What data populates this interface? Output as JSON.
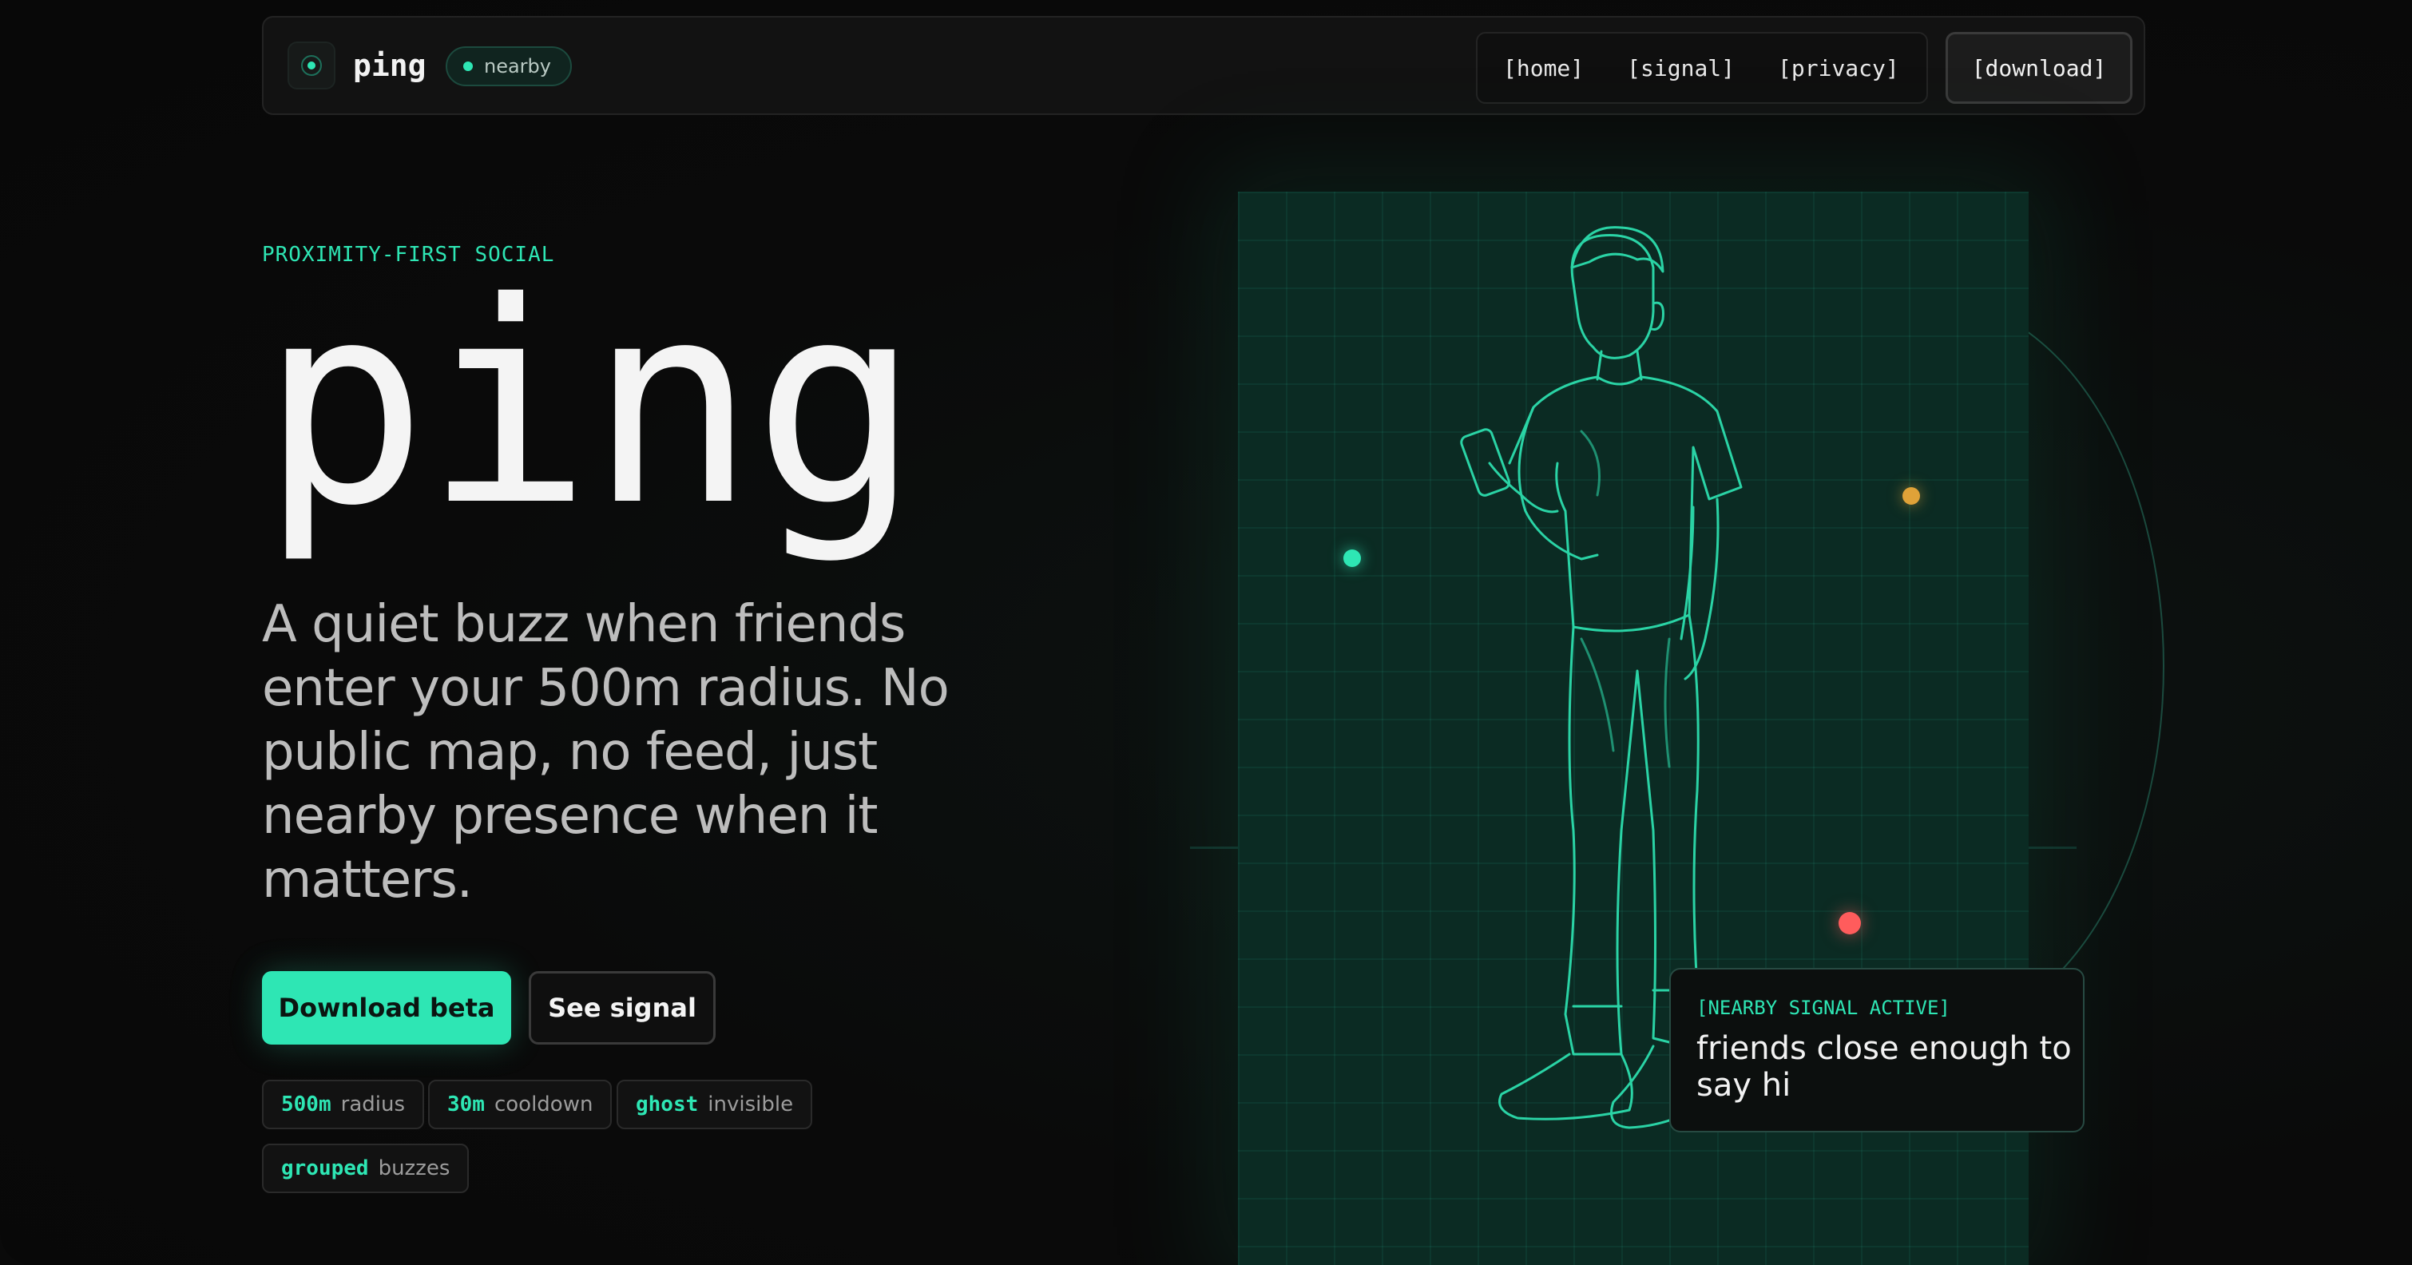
{
  "nav": {
    "brand": "ping",
    "status_pill": "nearby",
    "links": [
      "[home]",
      "[signal]",
      "[privacy]"
    ],
    "download": "[download]"
  },
  "hero": {
    "eyebrow": "PROXIMITY-FIRST SOCIAL",
    "title": "ping",
    "description_lines": [
      "A quiet buzz when friends",
      "enter your 500m radius. No",
      "public map, no feed, just",
      "nearby presence when it",
      "matters."
    ],
    "primary_button": "Download beta",
    "secondary_button": "See signal",
    "stats": [
      {
        "value": "500m",
        "label": "radius"
      },
      {
        "value": "30m",
        "label": "cooldown"
      },
      {
        "value": "ghost",
        "label": "invisible"
      },
      {
        "value": "grouped",
        "label": "buzzes"
      }
    ]
  },
  "signal_card": {
    "label": "[NEARBY SIGNAL ACTIVE]",
    "text_lines": [
      "friends close enough to",
      "say hi"
    ]
  },
  "colors": {
    "accent": "#2ee6b4",
    "blip_teal": "#2ee6b4",
    "blip_orange": "#e0a238",
    "blip_red": "#ff5c5c"
  },
  "icons": [
    "radar-logo-icon",
    "status-dot-icon",
    "person-illustration"
  ]
}
